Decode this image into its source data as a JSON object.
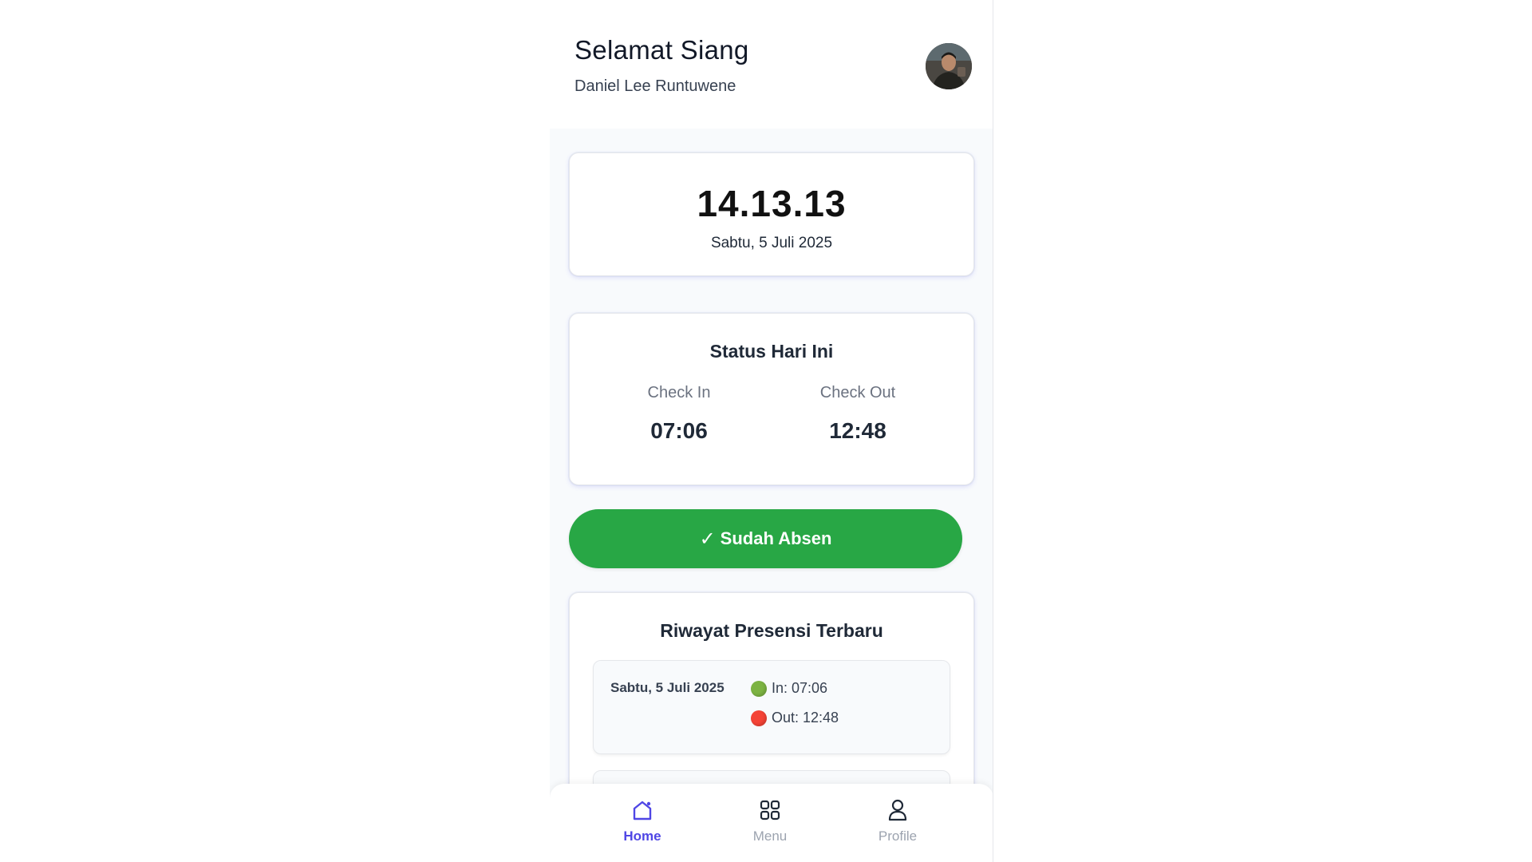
{
  "header": {
    "greeting": "Selamat Siang",
    "username": "Daniel Lee Runtuwene",
    "avatar_icon": "user-photo"
  },
  "clock": {
    "time": "14.13.13",
    "date": "Sabtu, 5 Juli 2025"
  },
  "status": {
    "title": "Status Hari Ini",
    "check_in_label": "Check In",
    "check_in_value": "07:06",
    "check_out_label": "Check Out",
    "check_out_value": "12:48"
  },
  "absen_button": {
    "icon": "✓",
    "label": "Sudah Absen",
    "color": "#28a745"
  },
  "history": {
    "title": "Riwayat Presensi Terbaru",
    "items": [
      {
        "date": "Sabtu, 5 Juli 2025",
        "in_label": "In: 07:06",
        "out_label": "Out: 12:48"
      }
    ]
  },
  "nav": {
    "items": [
      {
        "label": "Home",
        "icon": "home-icon",
        "active": true
      },
      {
        "label": "Menu",
        "icon": "grid-icon",
        "active": false
      },
      {
        "label": "Profile",
        "icon": "user-icon",
        "active": false
      }
    ],
    "active_color": "#4f46e5"
  }
}
